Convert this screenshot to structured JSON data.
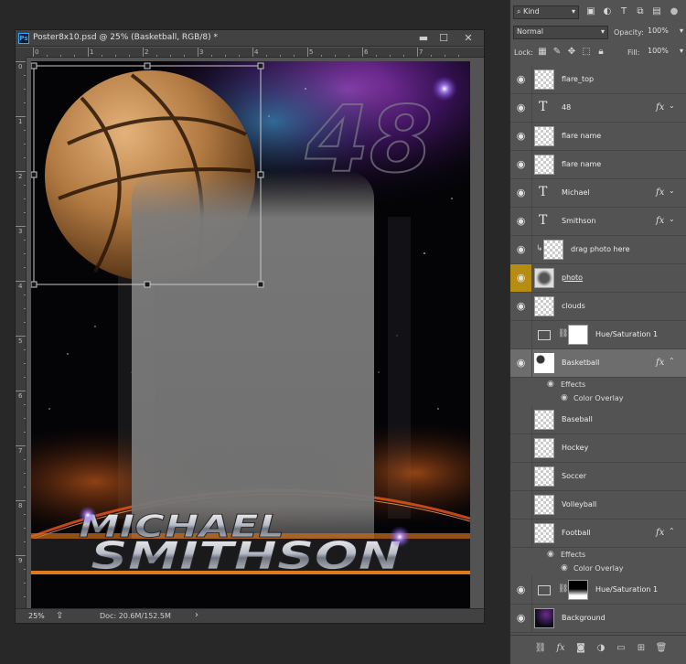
{
  "document": {
    "title": "Poster8x10.psd @ 25% (Basketball, RGB/8) *",
    "app_icon": "Ps",
    "controls": {
      "minimize": "▬",
      "maximize": "☐",
      "close": "✕"
    },
    "ruler_top": [
      "0",
      "1",
      "2",
      "3",
      "4",
      "5",
      "6",
      "7"
    ],
    "ruler_left": [
      "0",
      "1",
      "2",
      "3",
      "4",
      "5",
      "6",
      "7",
      "8",
      "9"
    ],
    "status": {
      "zoom": "25%",
      "doc": "Doc: 20.6M/152.5M",
      "arrow": "›"
    }
  },
  "poster": {
    "number": "48",
    "first_name": "MICHAEL",
    "last_name": "SMITHSON"
  },
  "panel": {
    "filter_kind": "Kind",
    "blend_mode": "Normal",
    "opacity_label": "Opacity:",
    "opacity_value": "100%",
    "lock_label": "Lock:",
    "fill_label": "Fill:",
    "fill_value": "100%",
    "layers": [
      {
        "name": "flare_top",
        "type": "pixel",
        "visible": true,
        "fx": false
      },
      {
        "name": "48",
        "type": "text",
        "visible": true,
        "fx": true
      },
      {
        "name": "flare name",
        "type": "pixel",
        "visible": true,
        "fx": false
      },
      {
        "name": "flare name",
        "type": "pixel",
        "visible": true,
        "fx": false
      },
      {
        "name": "Michael",
        "type": "text",
        "visible": true,
        "fx": true
      },
      {
        "name": "Smithson",
        "type": "text",
        "visible": true,
        "fx": true
      },
      {
        "name": "drag photo here",
        "type": "clipped",
        "visible": true,
        "fx": false
      },
      {
        "name": "photo",
        "type": "pixel",
        "visible": true,
        "fx": false,
        "highlight": true
      },
      {
        "name": "clouds",
        "type": "pixel",
        "visible": true,
        "fx": false
      },
      {
        "name": "Hue/Saturation 1",
        "type": "adjust-white",
        "visible": false,
        "fx": false
      },
      {
        "name": "Basketball",
        "type": "pixel",
        "visible": true,
        "fx": true,
        "selected": true
      },
      {
        "name": "Baseball",
        "type": "pixel",
        "visible": false,
        "fx": false
      },
      {
        "name": "Hockey",
        "type": "pixel",
        "visible": false,
        "fx": false
      },
      {
        "name": "Soccer",
        "type": "pixel",
        "visible": false,
        "fx": false
      },
      {
        "name": "Volleyball",
        "type": "pixel",
        "visible": false,
        "fx": false
      },
      {
        "name": "Football",
        "type": "pixel",
        "visible": false,
        "fx": true
      },
      {
        "name": "Hue/Saturation 1",
        "type": "adjust-gradient",
        "visible": true,
        "fx": false
      },
      {
        "name": "Background",
        "type": "background",
        "visible": true,
        "fx": false
      }
    ],
    "effects_label": "Effects",
    "color_overlay_label": "Color Overlay",
    "fx_label": "fx",
    "bottom_icons": [
      "link-icon",
      "fx-icon",
      "mask-icon",
      "adjustment-icon",
      "folder-icon",
      "new-layer-icon",
      "trash-icon"
    ]
  }
}
